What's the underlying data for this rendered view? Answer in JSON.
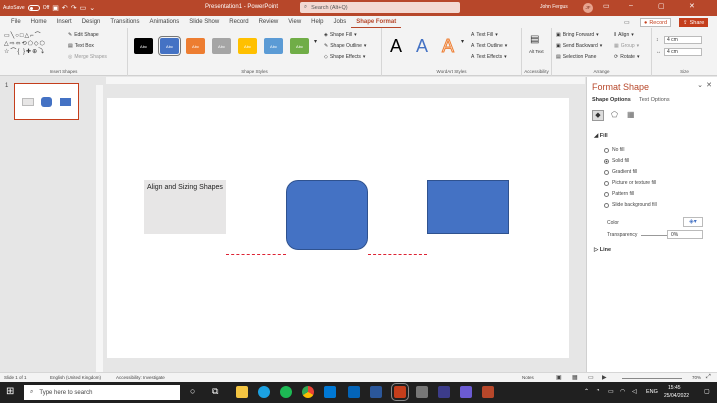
{
  "titlebar": {
    "autosave_label": "AutoSave",
    "autosave_state": "Off",
    "doc_title": "Presentation1",
    "app_name": "PowerPoint",
    "search_placeholder": "Search (Alt+Q)",
    "user_name": "John Fergus",
    "initials": "JF"
  },
  "menu": {
    "tabs": [
      "File",
      "Home",
      "Insert",
      "Design",
      "Transitions",
      "Animations",
      "Slide Show",
      "Record",
      "Review",
      "View",
      "Help",
      "Jobs",
      "Shape Format"
    ],
    "active_tab": "Shape Format",
    "record_label": "Record",
    "share_label": "Share"
  },
  "ribbon": {
    "insert_shapes": {
      "label": "Insert Shapes",
      "edit_shape": "Edit Shape",
      "text_box": "Text Box",
      "merge_shapes": "Merge Shapes"
    },
    "shape_styles": {
      "label": "Shape Styles",
      "swatch_text": "Abc",
      "swatches": [
        "#000000",
        "#4472c4",
        "#ed7d31",
        "#a5a5a5",
        "#ffc000",
        "#5b9bd5",
        "#70ad47"
      ],
      "shape_fill": "Shape Fill",
      "shape_outline": "Shape Outline",
      "shape_effects": "Shape Effects"
    },
    "wordart": {
      "label": "WordArt Styles",
      "letter": "A",
      "text_fill": "Text Fill",
      "text_outline": "Text Outline",
      "text_effects": "Text Effects"
    },
    "accessibility": {
      "label": "Accessibility",
      "alt_text": "Alt Text"
    },
    "arrange": {
      "label": "Arrange",
      "bring_forward": "Bring Forward",
      "send_backward": "Send Backward",
      "selection_pane": "Selection Pane",
      "align": "Align",
      "group": "Group",
      "rotate": "Rotate"
    },
    "size": {
      "label": "Size",
      "height": "4 cm",
      "width": "4 cm"
    }
  },
  "thumbnails": {
    "slide_number": "1"
  },
  "slide": {
    "textbox_text": "Align and Sizing Shapes"
  },
  "format_pane": {
    "title": "Format Shape",
    "tabs": [
      "Shape Options",
      "Text Options"
    ],
    "fill_section": "Fill",
    "fill_options": [
      "No fill",
      "Solid fill",
      "Gradient fill",
      "Picture or texture fill",
      "Pattern fill",
      "Slide background fill"
    ],
    "selected_fill": "Solid fill",
    "color_label": "Color",
    "transparency_label": "Transparency",
    "transparency_value": "0%",
    "line_section": "Line"
  },
  "statusbar": {
    "slide_info": "Slide 1 of 1",
    "language": "English (United Kingdom)",
    "accessibility": "Accessibility: Investigate",
    "notes": "Notes",
    "zoom": "70%"
  },
  "taskbar": {
    "search_placeholder": "Type here to search",
    "language": "ENG",
    "time": "15:45",
    "date": "25/04/2022"
  },
  "colors": {
    "accent": "#b7472a",
    "shape_blue": "#4472c4",
    "textbox_fill": "#e7e6e6"
  }
}
